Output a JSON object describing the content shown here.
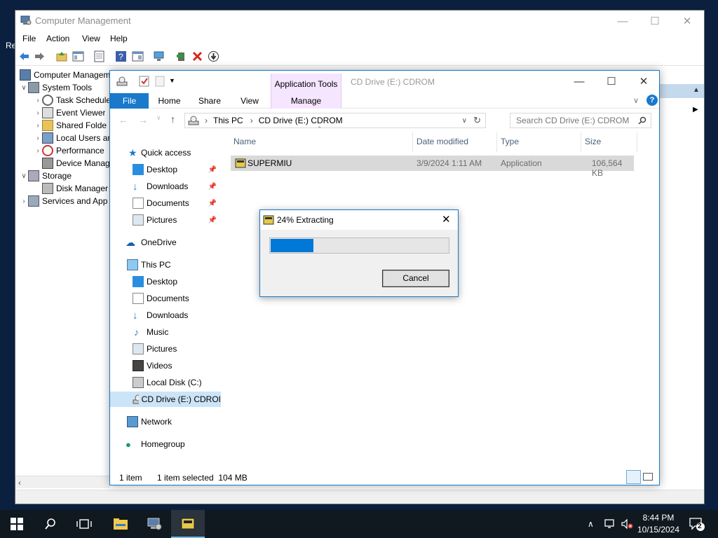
{
  "desktop": {
    "partial_label": "Re"
  },
  "computer_management": {
    "title": "Computer Management",
    "menu": [
      "File",
      "Action",
      "View",
      "Help"
    ],
    "toolbar_icons": [
      "back-arrow-icon",
      "forward-arrow-icon",
      "folder-up-icon",
      "console-tree-icon",
      "properties-icon",
      "help-icon",
      "show-hide-icon",
      "connect-computer-icon",
      "new-icon",
      "delete-icon",
      "download-icon"
    ],
    "tree": [
      {
        "label": "Computer Managem",
        "level": 0,
        "arrow": "",
        "icon": "computer-management-icon"
      },
      {
        "label": "System Tools",
        "level": 1,
        "arrow": "expanded",
        "icon": "system-tools-icon"
      },
      {
        "label": "Task Schedule",
        "level": 2,
        "arrow": "collapsed",
        "icon": "clock-icon"
      },
      {
        "label": "Event Viewer",
        "level": 2,
        "arrow": "collapsed",
        "icon": "event-viewer-icon"
      },
      {
        "label": "Shared Folde",
        "level": 2,
        "arrow": "collapsed",
        "icon": "shared-folder-icon"
      },
      {
        "label": "Local Users ar",
        "level": 2,
        "arrow": "collapsed",
        "icon": "users-icon"
      },
      {
        "label": "Performance",
        "level": 2,
        "arrow": "collapsed",
        "icon": "performance-icon"
      },
      {
        "label": "Device Manag",
        "level": 2,
        "arrow": "",
        "icon": "device-manager-icon"
      },
      {
        "label": "Storage",
        "level": 1,
        "arrow": "expanded",
        "icon": "storage-icon"
      },
      {
        "label": "Disk Manager",
        "level": 2,
        "arrow": "",
        "icon": "disk-icon"
      },
      {
        "label": "Services and App",
        "level": 1,
        "arrow": "collapsed",
        "icon": "services-icon"
      }
    ]
  },
  "explorer": {
    "title": "CD Drive (E:) CDROM",
    "context_tab_group": "Application Tools",
    "tabs": {
      "file": "File",
      "home": "Home",
      "share": "Share",
      "view": "View",
      "manage": "Manage"
    },
    "breadcrumb": {
      "root": "This PC",
      "current": "CD Drive (E:) CDROM"
    },
    "search_placeholder": "Search CD Drive (E:) CDROM",
    "nav": {
      "quick_access": "Quick access",
      "qa_desktop": "Desktop",
      "qa_downloads": "Downloads",
      "qa_documents": "Documents",
      "qa_pictures": "Pictures",
      "onedrive": "OneDrive",
      "this_pc": "This PC",
      "pc_desktop": "Desktop",
      "pc_documents": "Documents",
      "pc_downloads": "Downloads",
      "pc_music": "Music",
      "pc_pictures": "Pictures",
      "pc_videos": "Videos",
      "local_disk": "Local Disk (C:)",
      "cd_drive": "CD Drive (E:) CDROI",
      "network": "Network",
      "homegroup": "Homegroup"
    },
    "columns": {
      "name": "Name",
      "date": "Date modified",
      "type": "Type",
      "size": "Size"
    },
    "files": [
      {
        "name": "SUPERMIU",
        "date": "3/9/2024 1:11 AM",
        "type": "Application",
        "size": "106,564 KB"
      }
    ],
    "status": {
      "count": "1 item",
      "selected": "1 item selected  104 MB"
    }
  },
  "extract_dialog": {
    "title": "24% Extracting",
    "progress_fraction": 0.24,
    "cancel_label": "Cancel"
  },
  "taskbar": {
    "time": "8:44 PM",
    "date": "10/15/2024",
    "notification_count": "2"
  },
  "colors": {
    "accent": "#0078d7",
    "selection": "#cce4f7",
    "context_tab": "#f6e5ff",
    "taskbar": "#101820"
  }
}
